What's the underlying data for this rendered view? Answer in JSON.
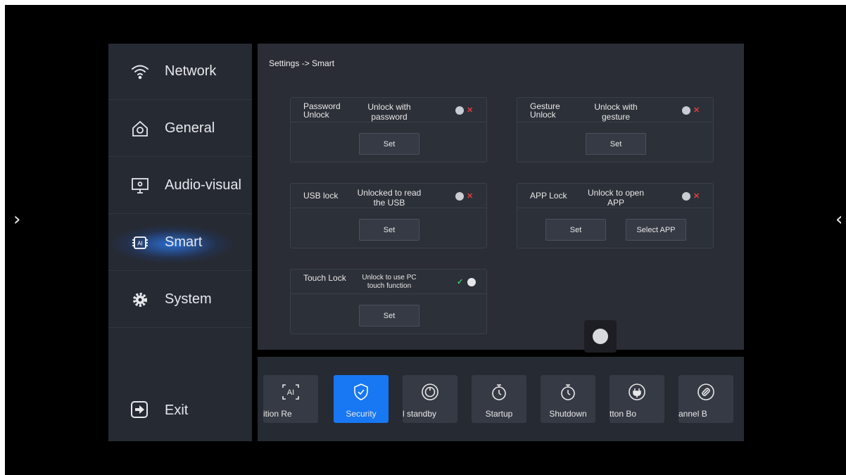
{
  "nav_arrows": {
    "left": "›",
    "right": "‹"
  },
  "sidebar": {
    "items": [
      {
        "label": "Network",
        "icon": "wifi-icon"
      },
      {
        "label": "General",
        "icon": "home-gear-icon"
      },
      {
        "label": "Audio-visual",
        "icon": "monitor-icon"
      },
      {
        "label": "Smart",
        "icon": "ai-chip-icon",
        "active": true
      },
      {
        "label": "System",
        "icon": "gear-icon"
      }
    ],
    "exit_label": "Exit"
  },
  "breadcrumb": "Settings -> Smart",
  "cards": {
    "password": {
      "title": "Password Unlock",
      "desc": "Unlock with password",
      "set": "Set",
      "enabled": false
    },
    "gesture": {
      "title": "Gesture Unlock",
      "desc": "Unlock with gesture",
      "set": "Set",
      "enabled": false
    },
    "usb": {
      "title": "USB lock",
      "desc": "Unlocked to read the USB",
      "set": "Set",
      "enabled": false
    },
    "app": {
      "title": "APP Lock",
      "desc": "Unlock to open APP",
      "set": "Set",
      "select": "Select APP",
      "enabled": false
    },
    "touch": {
      "title": "Touch Lock",
      "desc": "Unlock to use PC touch function",
      "set": "Set",
      "enabled": true
    }
  },
  "toggle_marks": {
    "off": "✕",
    "on": "✓"
  },
  "bottom_tiles": [
    {
      "label": "ition   Re",
      "icon": "ai-recognition-icon"
    },
    {
      "label": "Security",
      "icon": "shield-check-icon",
      "active": true
    },
    {
      "label": "l standby",
      "icon": "power-icon"
    },
    {
      "label": "Startup",
      "icon": "timer-icon"
    },
    {
      "label": "Shutdown",
      "icon": "timer-icon"
    },
    {
      "label": "tton    Bo",
      "icon": "power-button-icon"
    },
    {
      "label": "annel    B",
      "icon": "link-icon"
    }
  ],
  "colors": {
    "accent": "#1877f2",
    "toggle_off": "#e53d3d",
    "toggle_on": "#3fcf6a"
  }
}
